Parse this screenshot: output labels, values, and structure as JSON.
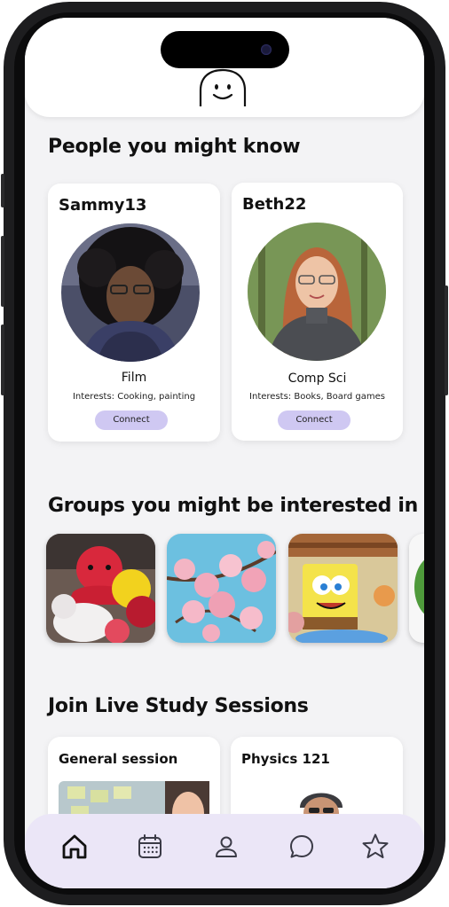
{
  "people_section": {
    "title": "People you might know",
    "people": [
      {
        "username": "Sammy13",
        "major": "Film",
        "interests": "Interests: Cooking, painting",
        "connect_label": "Connect"
      },
      {
        "username": "Beth22",
        "major": "Comp Sci",
        "interests": "Interests: Books, Board games",
        "connect_label": "Connect"
      }
    ]
  },
  "groups_section": {
    "title": "Groups you might be interested in"
  },
  "sessions_section": {
    "title": "Join Live Study Sessions",
    "sessions": [
      {
        "title": "General session"
      },
      {
        "title": "Physics 121"
      }
    ]
  },
  "tabbar": {
    "icons": [
      "home-icon",
      "calendar-icon",
      "profile-icon",
      "chat-icon",
      "star-icon"
    ],
    "active_index": 0
  },
  "colors": {
    "accent_button": "#cfc8f2",
    "tabbar_bg": "#ebe6f7",
    "screen_bg": "#f3f3f5"
  }
}
